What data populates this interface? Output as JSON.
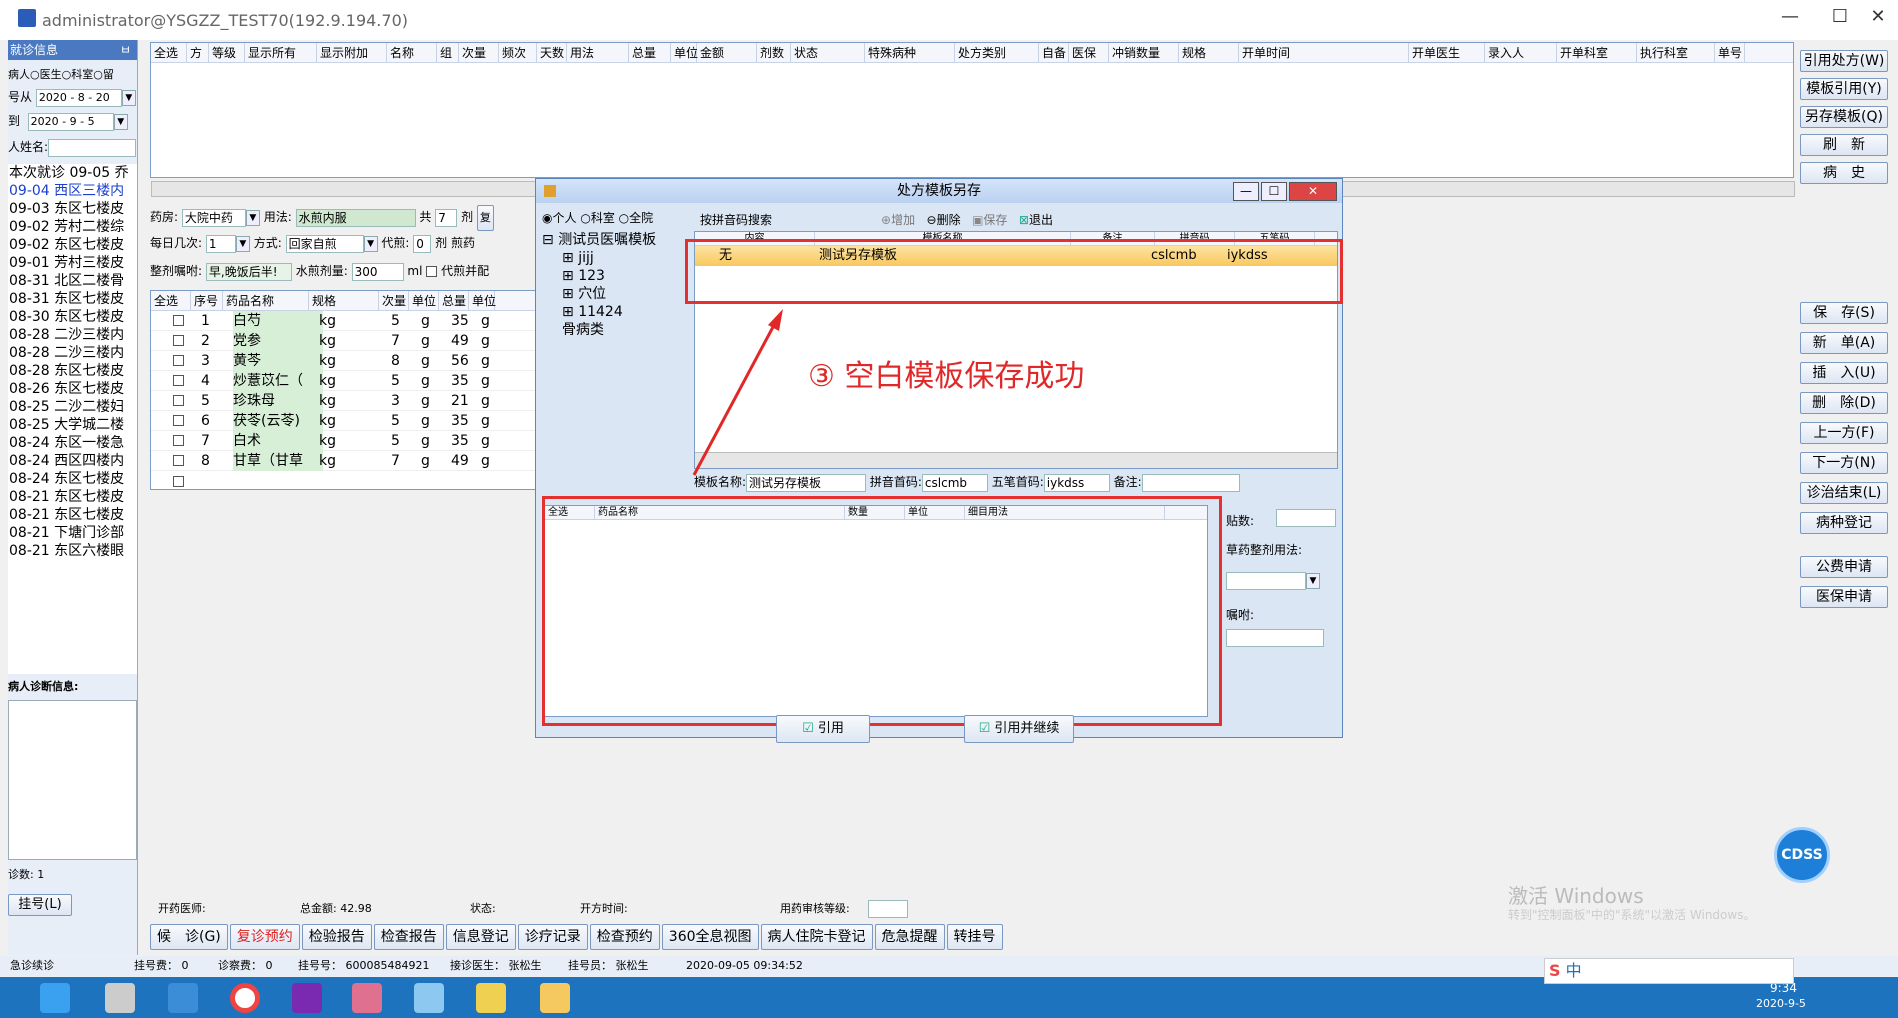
{
  "window": {
    "title": "administrator@YSGZZ_TEST70(192.9.194.70)",
    "ctl": [
      "—",
      "☐",
      "✕"
    ]
  },
  "left": {
    "header": "就诊信息",
    "pin": "ㅂ",
    "radios": [
      "病人",
      "医生",
      "科室",
      "留"
    ],
    "from_label": "号从",
    "from_date": "2020 - 8 - 20",
    "to_label": "到",
    "to_date": "2020 - 9 - 5",
    "name_label": "人姓名:",
    "visits": [
      "本次就诊 09-05 乔",
      "09-04 西区三楼内",
      "09-03 东区七楼皮",
      "09-02 芳村二楼综",
      "09-02 东区七楼皮",
      "09-01 芳村三楼皮",
      "08-31 北区二楼骨",
      "08-31 东区七楼皮",
      "08-30 东区七楼皮",
      "08-28 二沙三楼内",
      "08-28 二沙三楼内",
      "08-28 东区七楼皮",
      "08-26 东区七楼皮",
      "08-25 二沙二楼妇",
      "08-25 大学城二楼",
      "08-24 东区一楼急",
      "08-24 西区四楼内",
      "08-24 东区七楼皮",
      "08-21 东区七楼皮",
      "08-21 东区七楼皮",
      "08-21 下塘门诊部",
      "08-21 东区六楼眼"
    ],
    "diag_label": "病人诊断信息:",
    "count_label": "诊数: 1",
    "regno_btn": "挂号(L)",
    "status": "急诊续诊"
  },
  "top_grid": {
    "cols": [
      "全选",
      "方",
      "等级",
      "显示所有",
      "显示附加",
      "名称",
      "组",
      "次量",
      "频次",
      "天数",
      "用法",
      "总量",
      "单位",
      "金额",
      "剂数",
      "状态",
      "特殊病种",
      "处方类别",
      "自备",
      "医保",
      "冲销数量",
      "规格",
      "开单时间",
      "开单医生",
      "录入人",
      "开单科室",
      "执行科室",
      "单号"
    ]
  },
  "rx": {
    "pharmacy_label": "药房:",
    "pharmacy": "大院中药",
    "usage_label": "用法:",
    "usage": "水煎内服",
    "total_label": "共",
    "total": "7",
    "dose_unit": "剂",
    "review": "复",
    "freq_label": "每日几次:",
    "freq": "1",
    "method_label": "方式:",
    "method": "回家自煎",
    "decoct_label": "代煎:",
    "decoct": "0",
    "decoct_unit": "剂",
    "pre_label": "煎药",
    "instr_label": "整剂嘱咐:",
    "instr": "早,晚饭后半!",
    "water_label": "水煎剂量:",
    "water": "300",
    "water_unit": "ml",
    "merge_label": "代煎并配",
    "cols": [
      "全选",
      "序号",
      "药品名称",
      "规格",
      "次量",
      "单位",
      "总量",
      "单位"
    ],
    "rows": [
      [
        "1",
        "白芍",
        "kg",
        "5",
        "g",
        "35",
        "g"
      ],
      [
        "2",
        "党参",
        "kg",
        "7",
        "g",
        "49",
        "g"
      ],
      [
        "3",
        "黄芩",
        "kg",
        "8",
        "g",
        "56",
        "g"
      ],
      [
        "4",
        "炒薏苡仁（",
        "kg",
        "5",
        "g",
        "35",
        "g"
      ],
      [
        "5",
        "珍珠母",
        "kg",
        "3",
        "g",
        "21",
        "g"
      ],
      [
        "6",
        "茯苓(云苓)",
        "kg",
        "5",
        "g",
        "35",
        "g"
      ],
      [
        "7",
        "白术",
        "kg",
        "5",
        "g",
        "35",
        "g"
      ],
      [
        "8",
        "甘草（甘草",
        "kg",
        "7",
        "g",
        "49",
        "g"
      ]
    ]
  },
  "right_buttons": [
    "引用处方(W)",
    "模板引用(Y)",
    "另存模板(Q)",
    "刷　新",
    "病　史",
    "保　存(S)",
    "新　单(A)",
    "插　入(U)",
    "删　除(D)",
    "上一方(F)",
    "下一方(N)",
    "诊治结束(L)",
    "病种登记",
    "公费申请",
    "医保申请"
  ],
  "bottom_info": {
    "doctor": "开药医师:",
    "amount": "总金额: 42.98",
    "status": "状态:",
    "time": "开方时间:",
    "audit": "用药审核等级:"
  },
  "bottom_buttons": [
    "候　诊(G)",
    "复诊预约",
    "检验报告",
    "检查报告",
    "信息登记",
    "诊疗记录",
    "检查预约",
    "360全息视图",
    "病人住院卡登记",
    "危急提醒",
    "转挂号"
  ],
  "statusbar": {
    "reg_fee": "挂号费： 0",
    "diag_fee": "诊察费： 0",
    "reg_no": "挂号号： 600085484921",
    "doctor": "接诊医生： 张松生",
    "reg_staff": "挂号员： 张松生",
    "time": "2020-09-05 09:34:52"
  },
  "dialog": {
    "title": "处方模板另存",
    "scope": [
      "个人",
      "科室",
      "全院"
    ],
    "search_label": "按拼音码搜索",
    "tools": [
      "增加",
      "删除",
      "保存",
      "退出"
    ],
    "tree_root": "测试员医嘱模板",
    "tree_items": [
      "jijj",
      "123",
      "穴位",
      "11424",
      "骨病类"
    ],
    "tpl_cols": [
      "内容",
      "模板名称",
      "备注",
      "拼音码",
      "五笔码"
    ],
    "tpl_row": {
      "content": "无",
      "name": "测试另存模板",
      "pinyin": "cslcmb",
      "wubi": "iykdss"
    },
    "annotation": "③ 空白模板保存成功",
    "name_label": "模板名称:",
    "name_val": "测试另存模板",
    "py_label": "拼音首码:",
    "py_val": "cslcmb",
    "wb_label": "五笔首码:",
    "wb_val": "iykdss",
    "note_label": "备注:",
    "drug_cols": [
      "全选",
      "药品名称",
      "数量",
      "单位",
      "细目用法"
    ],
    "dose_label": "贴数:",
    "method_label": "草药整剂用法:",
    "instr_label": "嘱咐:",
    "btn_ref": "引用",
    "btn_ref_cont": "引用并继续"
  },
  "overlay": {
    "cdss": "CDSS",
    "watermark1": "激活 Windows",
    "watermark2": "转到\"控制面板\"中的\"系统\"以激活 Windows。",
    "clock": "9:34",
    "date": "2020-9-5",
    "ime": "中"
  }
}
